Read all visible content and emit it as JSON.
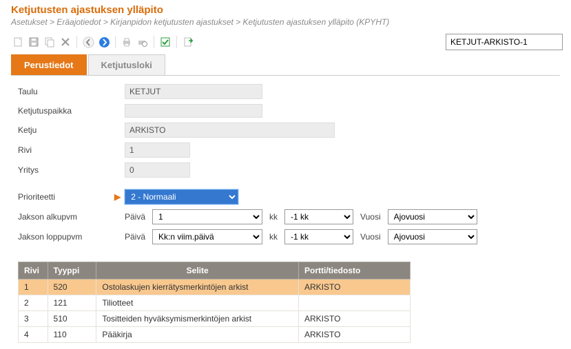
{
  "title": "Ketjutusten ajastuksen ylläpito",
  "breadcrumb": "Asetukset > Eräajotiedot > Kirjanpidon ketjutusten ajastukset > Ketjutusten ajastuksen ylläpito  (KPYHT)",
  "search_value": "KETJUT-ARKISTO-1",
  "tabs": {
    "perustiedot": "Perustiedot",
    "ketjutusloki": "Ketjutusloki"
  },
  "form": {
    "labels": {
      "taulu": "Taulu",
      "ketjutuspaikka": "Ketjutuspaikka",
      "ketju": "Ketju",
      "rivi": "Rivi",
      "yritys": "Yritys",
      "prioriteetti": "Prioriteetti",
      "jakson_alkupvm": "Jakson alkupvm",
      "jakson_loppupvm": "Jakson loppupvm",
      "paiva": "Päivä",
      "kk": "kk",
      "vuosi": "Vuosi"
    },
    "values": {
      "taulu": "KETJUT",
      "ketjutuspaikka": "",
      "ketju": "ARKISTO",
      "rivi": "1",
      "yritys": "0",
      "prioriteetti": "2  -  Normaali",
      "alkupvm_paiva": "1",
      "alkupvm_kk": "-1 kk",
      "alkupvm_vuosi": "Ajovuosi",
      "loppupvm_paiva": "Kk:n viim.päivä",
      "loppupvm_kk": "-1 kk",
      "loppupvm_vuosi": "Ajovuosi"
    }
  },
  "grid": {
    "headers": {
      "rivi": "Rivi",
      "tyyppi": "Tyyppi",
      "selite": "Selite",
      "portti": "Portti/tiedosto"
    },
    "rows": [
      {
        "rivi": "1",
        "tyyppi": "520",
        "selite": "Ostolaskujen kierrätysmerkintöjen arkist",
        "portti": "ARKISTO",
        "selected": true
      },
      {
        "rivi": "2",
        "tyyppi": "121",
        "selite": "Tiliotteet",
        "portti": "",
        "selected": false
      },
      {
        "rivi": "3",
        "tyyppi": "510",
        "selite": "Tositteiden hyväksymismerkintöjen arkist",
        "portti": "ARKISTO",
        "selected": false
      },
      {
        "rivi": "4",
        "tyyppi": "110",
        "selite": "Pääkirja",
        "portti": "ARKISTO",
        "selected": false
      }
    ]
  },
  "icons": {
    "new": "new",
    "save": "save",
    "copy": "copy",
    "delete": "delete",
    "back": "back",
    "forward": "forward",
    "print": "print",
    "preview": "preview",
    "check": "check",
    "export": "export"
  }
}
